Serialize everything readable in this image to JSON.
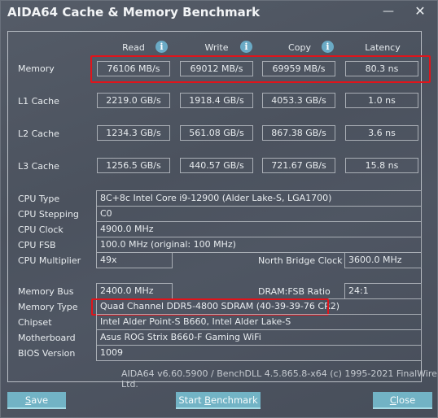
{
  "window": {
    "title": "AIDA64 Cache & Memory Benchmark",
    "minimize_icon": "minimize-icon",
    "close_icon": "close-icon"
  },
  "columns": [
    {
      "label": "Read",
      "info_icon": "info-icon"
    },
    {
      "label": "Write",
      "info_icon": "info-icon"
    },
    {
      "label": "Copy",
      "info_icon": "info-icon"
    },
    {
      "label": "Latency"
    }
  ],
  "benchmark_rows": [
    {
      "label": "Memory",
      "read": "76106 MB/s",
      "write": "69012 MB/s",
      "copy": "69959 MB/s",
      "latency": "80.3 ns",
      "highlighted": true
    },
    {
      "label": "L1 Cache",
      "read": "2219.0 GB/s",
      "write": "1918.4 GB/s",
      "copy": "4053.3 GB/s",
      "latency": "1.0 ns"
    },
    {
      "label": "L2 Cache",
      "read": "1234.3 GB/s",
      "write": "561.08 GB/s",
      "copy": "867.38 GB/s",
      "latency": "3.6 ns"
    },
    {
      "label": "L3 Cache",
      "read": "1256.5 GB/s",
      "write": "440.57 GB/s",
      "copy": "721.67 GB/s",
      "latency": "15.8 ns"
    }
  ],
  "cpu_info": {
    "cpu_type": {
      "label": "CPU Type",
      "value": "8C+8c Intel Core i9-12900  (Alder Lake-S, LGA1700)"
    },
    "cpu_stepping": {
      "label": "CPU Stepping",
      "value": "C0"
    },
    "cpu_clock": {
      "label": "CPU Clock",
      "value": "4900.0 MHz"
    },
    "cpu_fsb": {
      "label": "CPU FSB",
      "value": "100.0 MHz  (original: 100 MHz)"
    },
    "cpu_multiplier": {
      "label": "CPU Multiplier",
      "value": "49x"
    },
    "north_bridge_clock": {
      "label": "North Bridge Clock",
      "value": "3600.0 MHz"
    }
  },
  "memory_info": {
    "memory_bus": {
      "label": "Memory Bus",
      "value": "2400.0 MHz"
    },
    "dram_fsb_ratio": {
      "label": "DRAM:FSB Ratio",
      "value": "24:1"
    },
    "memory_type": {
      "label": "Memory Type",
      "value": "Quad Channel DDR5-4800 SDRAM  (40-39-39-76 CR2)",
      "highlighted": true
    },
    "chipset": {
      "label": "Chipset",
      "value": "Intel Alder Point-S B660, Intel Alder Lake-S"
    },
    "motherboard": {
      "label": "Motherboard",
      "value": "Asus ROG Strix B660-F Gaming WiFi"
    },
    "bios_version": {
      "label": "BIOS Version",
      "value": "1009"
    }
  },
  "footer": "AIDA64 v6.60.5900 / BenchDLL 4.5.865.8-x64  (c) 1995-2021 FinalWire Ltd.",
  "buttons": {
    "save": {
      "pre": "",
      "accel": "S",
      "post": "ave"
    },
    "start": {
      "pre": "Start ",
      "accel": "B",
      "post": "enchmark"
    },
    "close": {
      "pre": "",
      "accel": "C",
      "post": "lose"
    }
  },
  "colors": {
    "highlight": "#e0141b",
    "button": "#72b3c5",
    "info_icon": "#6aaac5",
    "background": "#4b5260"
  }
}
